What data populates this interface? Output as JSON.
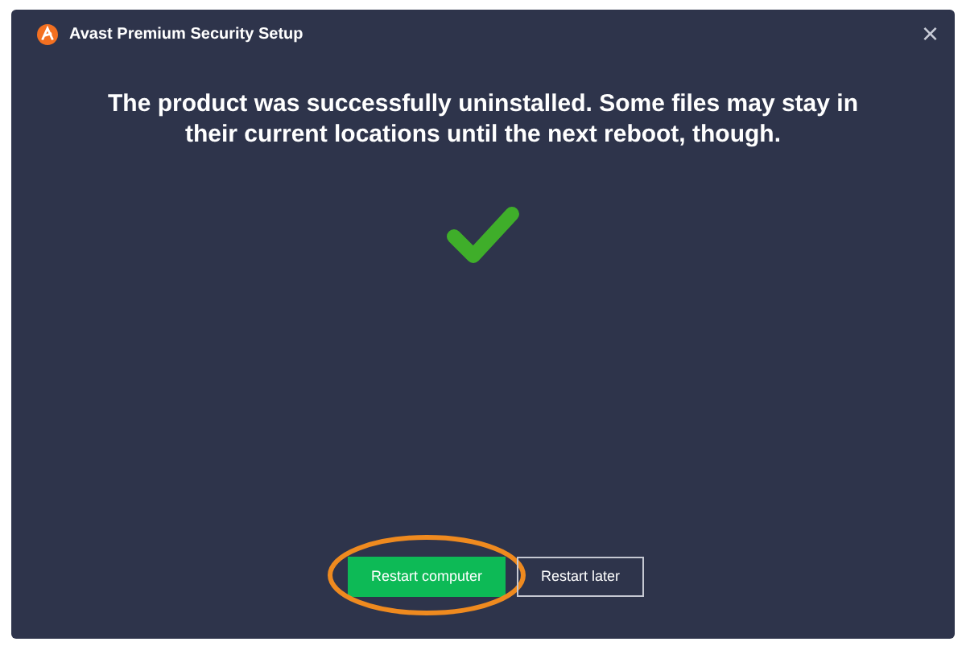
{
  "window": {
    "title": "Avast Premium Security Setup",
    "close": "×"
  },
  "message": "The product was successfully uninstalled. Some files may stay in their current locations until the next reboot, though.",
  "buttons": [
    {
      "label": "Restart computer",
      "kind": "primary",
      "highlighted": true
    },
    {
      "label": "Restart later",
      "kind": "secondary",
      "highlighted": false
    }
  ]
}
